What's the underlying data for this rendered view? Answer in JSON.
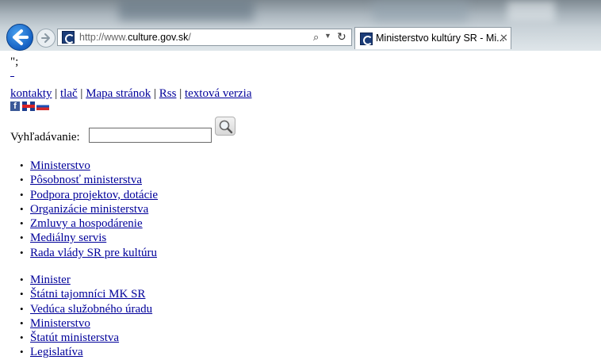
{
  "browser": {
    "url_prefix": "http://www.",
    "url_domain": "culture.gov.sk",
    "url_suffix": "/",
    "tab_title": "Ministerstvo kultúry SR - Mi...",
    "icons": [
      "back-arrow-icon",
      "forward-arrow-icon",
      "site-favicon",
      "search-icon",
      "dropdown-icon",
      "refresh-icon",
      "close-icon"
    ]
  },
  "page": {
    "stray_text": "\";",
    "topnav": [
      {
        "label": "kontakty"
      },
      {
        "label": "tlač"
      },
      {
        "label": "Mapa stránok"
      },
      {
        "label": "Rss"
      },
      {
        "label": "textová verzia"
      }
    ],
    "separator": "|",
    "social": [
      {
        "icon": "facebook-icon",
        "glyph": "f"
      },
      {
        "icon": "english-flag-icon"
      },
      {
        "icon": "slovak-flag-icon"
      }
    ],
    "search": {
      "label": "Vyhľadávanie:",
      "value": ""
    },
    "menu_primary": [
      {
        "label": "Ministerstvo"
      },
      {
        "label": "Pôsobnosť ministerstva"
      },
      {
        "label": "Podpora projektov, dotácie"
      },
      {
        "label": "Organizácie ministerstva"
      },
      {
        "label": "Zmluvy a hospodárenie"
      },
      {
        "label": "Mediálny servis"
      },
      {
        "label": "Rada vlády SR pre kultúru"
      }
    ],
    "menu_secondary": [
      {
        "label": "Minister"
      },
      {
        "label": "Štátni tajomníci MK SR"
      },
      {
        "label": "Vedúca služobného úradu"
      },
      {
        "label": "Ministerstvo"
      },
      {
        "label": "Štatút ministerstva"
      },
      {
        "label": "Legislatíva"
      }
    ]
  }
}
